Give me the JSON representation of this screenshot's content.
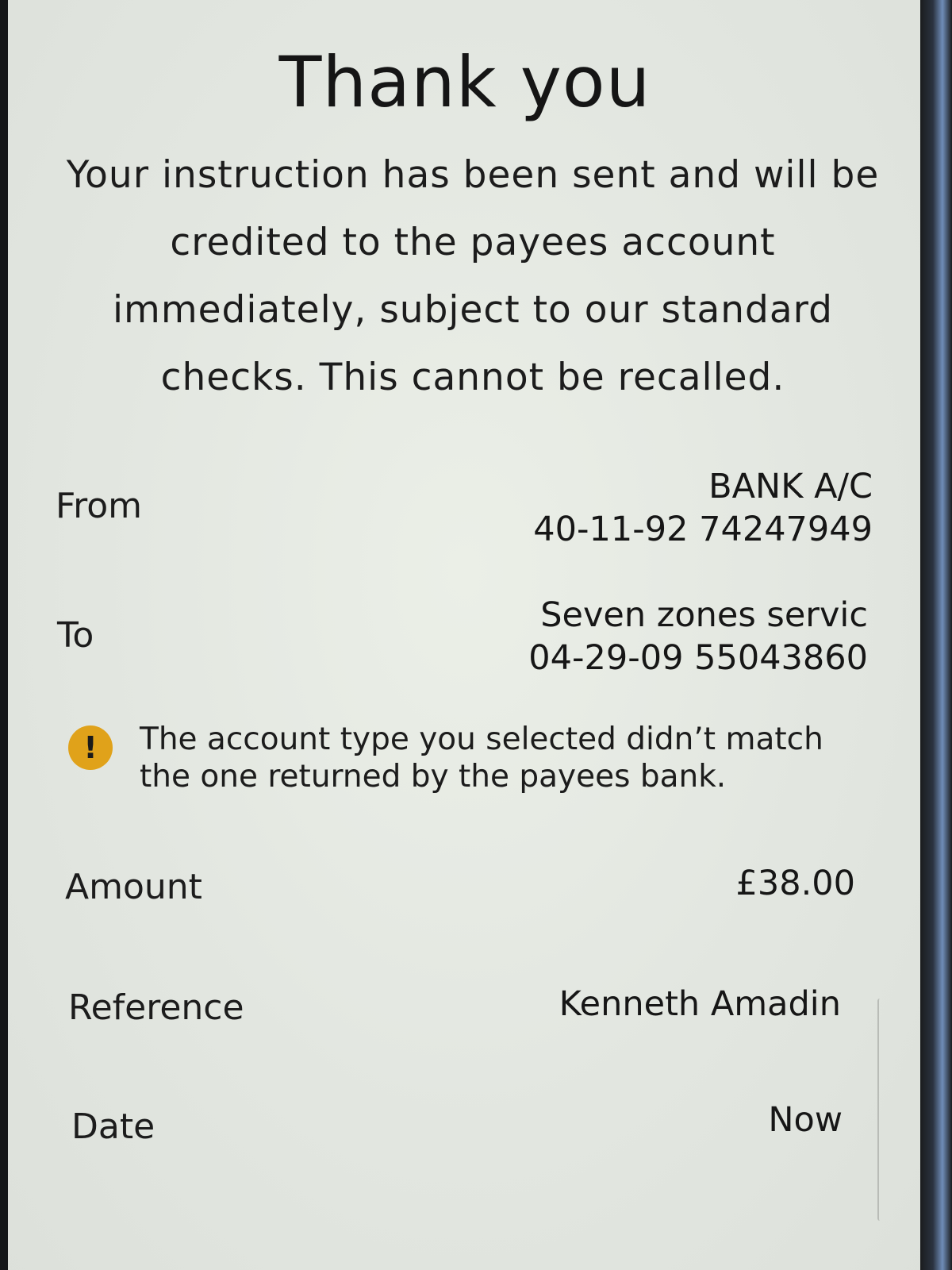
{
  "confirmation": {
    "title": "Thank you",
    "message": "Your instruction has been sent and will be credited to the payees account immediately, subject to our standard checks.  This cannot be recalled."
  },
  "from": {
    "label": "From",
    "account_name": "BANK A/C",
    "account_number": "40-11-92 74247949"
  },
  "to": {
    "label": "To",
    "payee_name": "Seven zones servic",
    "account_number": "04-29-09 55043860"
  },
  "warning": {
    "icon": "exclamation-icon",
    "icon_color": "#e0a21a",
    "text": "The account type you selected didn’t match the one returned by the payees bank."
  },
  "amount": {
    "label": "Amount",
    "value": "£38.00"
  },
  "reference": {
    "label": "Reference",
    "value": "Kenneth Amadin"
  },
  "date": {
    "label": "Date",
    "value": "Now"
  }
}
